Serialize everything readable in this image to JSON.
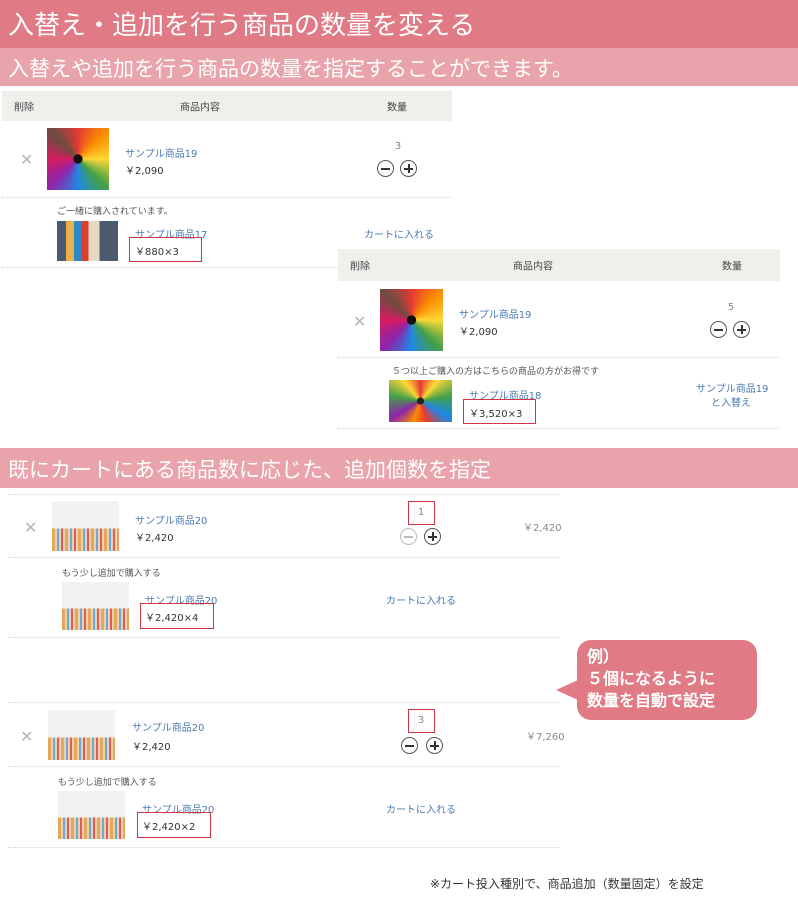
{
  "banners": {
    "main": "入替え・追加を行う商品の数量を変える",
    "sub": "入替えや追加を行う商品の数量を指定することができます。",
    "section2": "既にカートにある商品数に応じた、追加個数を指定"
  },
  "headers": {
    "delete": "削除",
    "product": "商品内容",
    "qty": "数量"
  },
  "cart1": {
    "item": {
      "name": "サンプル商品19",
      "price": "￥2,090",
      "qty": "3"
    },
    "note": "ご一緒に購入されています。",
    "offer": {
      "name": "サンプル商品17",
      "price": "￥880×3",
      "action": "カートに入れる"
    }
  },
  "cart2": {
    "item": {
      "name": "サンプル商品19",
      "price": "￥2,090",
      "qty": "5"
    },
    "note": "５つ以上ご購入の方はこちらの商品の方がお得です",
    "offer": {
      "name": "サンプル商品18",
      "price": "￥3,520×3",
      "action_line1": "サンプル商品19",
      "action_line2": "と入替え"
    }
  },
  "cart3": {
    "item": {
      "name": "サンプル商品20",
      "price": "￥2,420",
      "qty": "1",
      "subtotal": "￥2,420"
    },
    "note": "もう少し追加で購入する",
    "offer": {
      "name": "サンプル商品20",
      "price": "￥2,420×4",
      "action": "カートに入れる"
    }
  },
  "cart4": {
    "item": {
      "name": "サンプル商品20",
      "price": "￥2,420",
      "qty": "3",
      "subtotal": "￥7,260"
    },
    "note": "もう少し追加で購入する",
    "offer": {
      "name": "サンプル商品20",
      "price": "￥2,420×2",
      "action": "カートに入れる"
    }
  },
  "callout": {
    "line1": "例）",
    "line2": "５個になるように",
    "line3": "数量を自動で設定"
  },
  "footer_note": "※カート投入種別で、商品追加（数量固定）を設定",
  "colors": {
    "banner": "#e07b86",
    "banner_light": "#e9a3ab",
    "link": "#4a7ab3",
    "highlight_border": "#cf3545"
  }
}
